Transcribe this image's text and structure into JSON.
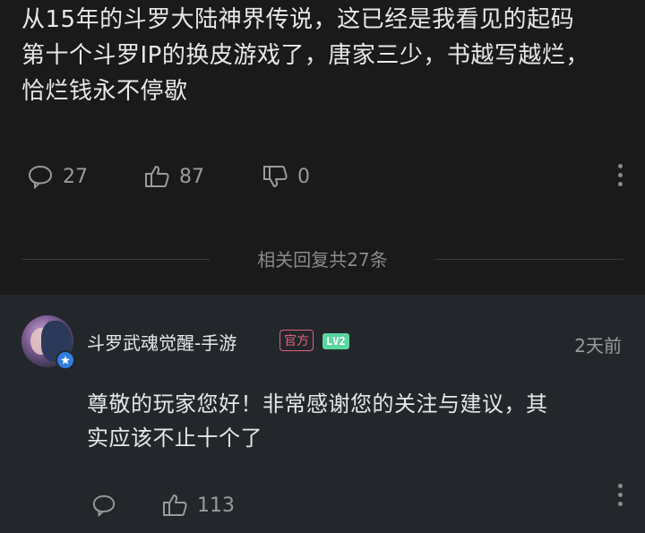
{
  "post": {
    "text_lines": [
      "从15年的斗罗大陆神界传说，这已经是我看见的起码",
      "第十个斗罗IP的换皮游戏了，唐家三少，书越写越烂，",
      "恰烂钱永不停歇"
    ],
    "comments_count": "27",
    "likes_count": "87",
    "dislikes_count": "0"
  },
  "replies_divider": "相关回复共27条",
  "reply": {
    "username": "斗罗武魂觉醒-手游",
    "official_badge": "官方",
    "level_badge": "LV2",
    "time": "2天前",
    "text_lines": [
      "尊敬的玩家您好！非常感谢您的关注与建议，其",
      "实应该不止十个了"
    ],
    "likes_count": "113"
  },
  "colors": {
    "background": "#1a1a1a",
    "reply_background": "#23272c",
    "official_badge": "#e5607c",
    "level_badge": "#5ad6a0",
    "verified": "#2f7de1"
  }
}
